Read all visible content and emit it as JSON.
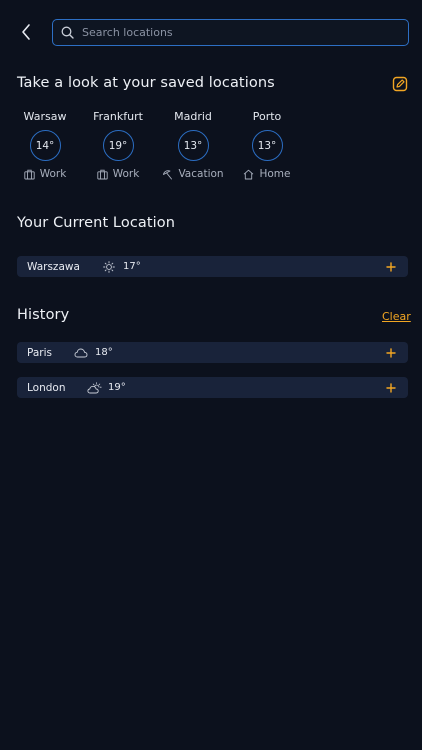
{
  "search": {
    "placeholder": "Search locations",
    "value": ""
  },
  "saved": {
    "title": "Take a look at your saved locations",
    "items": [
      {
        "city": "Warsaw",
        "temp": "14°",
        "tag": "Work",
        "tag_icon": "briefcase-icon"
      },
      {
        "city": "Frankfurt",
        "temp": "19°",
        "tag": "Work",
        "tag_icon": "briefcase-icon"
      },
      {
        "city": "Madrid",
        "temp": "13°",
        "tag": "Vacation",
        "tag_icon": "beach-umbrella-icon"
      },
      {
        "city": "Porto",
        "temp": "13°",
        "tag": "Home",
        "tag_icon": "home-icon"
      }
    ]
  },
  "current": {
    "title": "Your Current Location",
    "city": "Warszawa",
    "temp": "17°",
    "icon": "sun-icon"
  },
  "history": {
    "title": "History",
    "clear_label": "Clear",
    "items": [
      {
        "city": "Paris",
        "temp": "18°",
        "icon": "cloud-icon"
      },
      {
        "city": "London",
        "temp": "19°",
        "icon": "partly-cloudy-icon"
      }
    ]
  },
  "colors": {
    "accent": "#f2a623",
    "outline": "#2b6dc2",
    "background": "#0c111d",
    "row": "#19233a"
  }
}
